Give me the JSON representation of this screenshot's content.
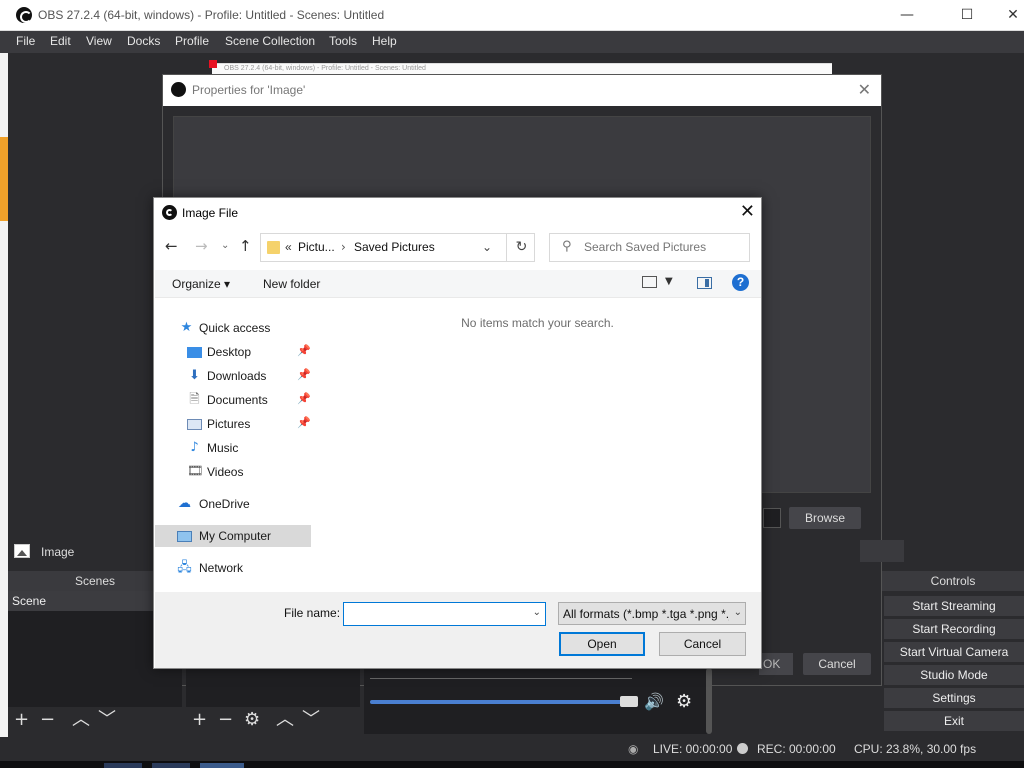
{
  "obs": {
    "title": "OBS 27.2.4 (64-bit, windows) - Profile: Untitled - Scenes: Untitled",
    "menu": [
      "File",
      "Edit",
      "View",
      "Docks",
      "Profile",
      "Scene Collection",
      "Tools",
      "Help"
    ],
    "ghost_title": "OBS 27.2.4 (64-bit, windows) - Profile: Untitled - Scenes: Untitled",
    "source_name": "Image",
    "scenes_header": "Scenes",
    "scene_item": "Scene",
    "controls_header": "Controls",
    "controls": [
      "Start Streaming",
      "Start Recording",
      "Start Virtual Camera",
      "Studio Mode",
      "Settings",
      "Exit"
    ],
    "status": {
      "live": "LIVE: 00:00:00",
      "rec": "REC: 00:00:00",
      "cpu": "CPU: 23.8%, 30.00 fps"
    },
    "window_controls": {
      "minimize": "—",
      "maximize": "☐",
      "close": "✕"
    }
  },
  "properties": {
    "title": "Properties for 'Image'",
    "browse_label": "Browse",
    "ok_label": "OK",
    "cancel_label": "Cancel"
  },
  "dialog": {
    "title": "Image File",
    "address": {
      "overflow": "«",
      "crumb1": "Pictu...",
      "crumb2": "Saved Pictures"
    },
    "search": {
      "placeholder": "Search Saved Pictures"
    },
    "commands": {
      "organize": "Organize ▾",
      "new_folder": "New folder",
      "help": "?"
    },
    "nav": {
      "quick_access": "Quick access",
      "desktop": "Desktop",
      "downloads": "Downloads",
      "documents": "Documents",
      "pictures": "Pictures",
      "music": "Music",
      "videos": "Videos",
      "onedrive": "OneDrive",
      "my_computer": "My Computer",
      "network": "Network"
    },
    "empty_message": "No items match your search.",
    "file_name_label": "File name:",
    "file_name_value": "",
    "filter_value": "All formats (*.bmp *.tga *.png *.jpeg *.jpg *.gif *.psd *.webp)",
    "open_label": "Open",
    "cancel_label": "Cancel"
  },
  "colors": {
    "obs_bg": "#2b2b2e",
    "accent_blue": "#0078d7",
    "selection": "#d9d9d9"
  }
}
